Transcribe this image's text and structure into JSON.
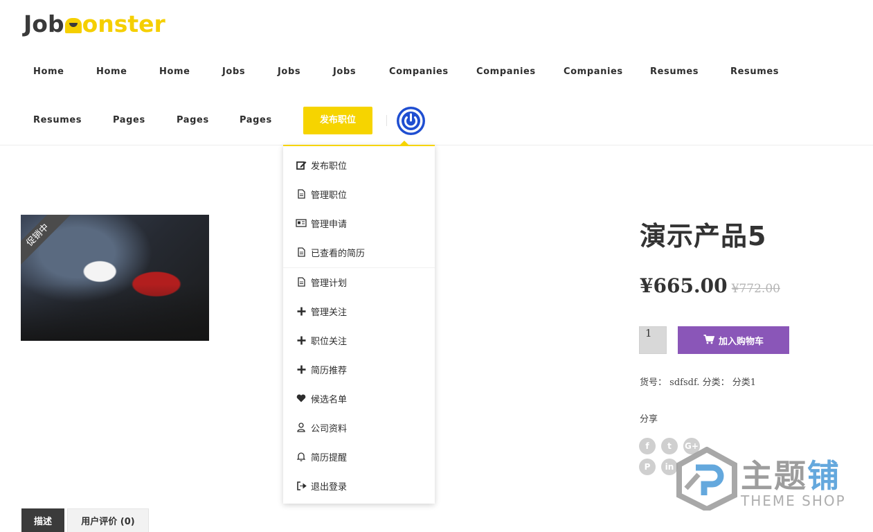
{
  "logo": {
    "part1": "Job",
    "part2": "onster"
  },
  "nav": {
    "row1": [
      "Home",
      "Home",
      "Home",
      "Jobs",
      "Jobs",
      "Jobs",
      "Companies",
      "Companies",
      "Companies",
      "Resumes",
      "Resumes"
    ],
    "row2": [
      "Resumes",
      "Pages",
      "Pages",
      "Pages"
    ],
    "post_job_label": "发布职位"
  },
  "dropdown": {
    "items": [
      {
        "label": "发布职位",
        "icon": "edit-icon"
      },
      {
        "label": "管理职位",
        "icon": "file-icon"
      },
      {
        "label": "管理申请",
        "icon": "id-card-icon"
      },
      {
        "label": "已查看的简历",
        "icon": "file-icon"
      },
      {
        "label": "管理计划",
        "icon": "file-icon"
      },
      {
        "label": "管理关注",
        "icon": "plus-icon"
      },
      {
        "label": "职位关注",
        "icon": "plus-icon"
      },
      {
        "label": "简历推荐",
        "icon": "plus-icon"
      },
      {
        "label": "候选名单",
        "icon": "heart-icon"
      },
      {
        "label": "公司资料",
        "icon": "user-icon"
      },
      {
        "label": "简历提醒",
        "icon": "bell-icon"
      },
      {
        "label": "退出登录",
        "icon": "sign-out-icon"
      }
    ]
  },
  "product": {
    "sale_badge": "促销中",
    "title": "演示产品5",
    "price": "¥665.00",
    "old_price": "¥772.00",
    "quantity": "1",
    "add_to_cart": "加入购物车",
    "sku_label": "货号：",
    "sku": "sdfsdf.",
    "category_label": "分类：",
    "category": "分类1",
    "share_label": "分享"
  },
  "share_icons": [
    {
      "name": "facebook-icon",
      "glyph": "f"
    },
    {
      "name": "twitter-icon",
      "glyph": "t"
    },
    {
      "name": "google-plus-icon",
      "glyph": "G+"
    },
    {
      "name": "pinterest-icon",
      "glyph": "P"
    },
    {
      "name": "linkedin-icon",
      "glyph": "in"
    }
  ],
  "tabs": {
    "description": "描述",
    "reviews": "用户评价 (0)"
  },
  "watermark": {
    "main1": "主题",
    "main2": "铺",
    "sub": "THEME SHOP"
  },
  "colors": {
    "accent_yellow": "#f6d400",
    "power_blue": "#1f4ed1",
    "cart_purple": "#8a56b8"
  }
}
